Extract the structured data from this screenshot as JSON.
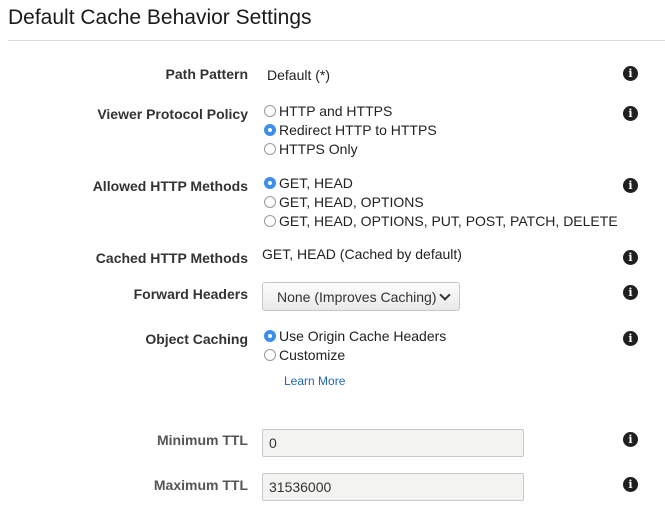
{
  "title": "Default Cache Behavior Settings",
  "path_pattern": {
    "label": "Path Pattern",
    "value": "Default (*)"
  },
  "viewer_protocol_policy": {
    "label": "Viewer Protocol Policy",
    "options": [
      "HTTP and HTTPS",
      "Redirect HTTP to HTTPS",
      "HTTPS Only"
    ],
    "selected": "Redirect HTTP to HTTPS"
  },
  "allowed_http_methods": {
    "label": "Allowed HTTP Methods",
    "options": [
      "GET, HEAD",
      "GET, HEAD, OPTIONS",
      "GET, HEAD, OPTIONS, PUT, POST, PATCH, DELETE"
    ],
    "selected": "GET, HEAD"
  },
  "cached_http_methods": {
    "label": "Cached HTTP Methods",
    "value": "GET, HEAD (Cached by default)"
  },
  "forward_headers": {
    "label": "Forward Headers",
    "selected": "None (Improves Caching)"
  },
  "object_caching": {
    "label": "Object Caching",
    "options": [
      "Use Origin Cache Headers",
      "Customize"
    ],
    "selected": "Use Origin Cache Headers",
    "learn_more": "Learn More"
  },
  "minimum_ttl": {
    "label": "Minimum TTL",
    "value": "0"
  },
  "maximum_ttl": {
    "label": "Maximum TTL",
    "value": "31536000"
  },
  "info_icon_glyph": "i",
  "colors": {
    "radio_selected": "#3d8eea",
    "link": "#1f65b5",
    "input_background": "#f3f3f1"
  }
}
